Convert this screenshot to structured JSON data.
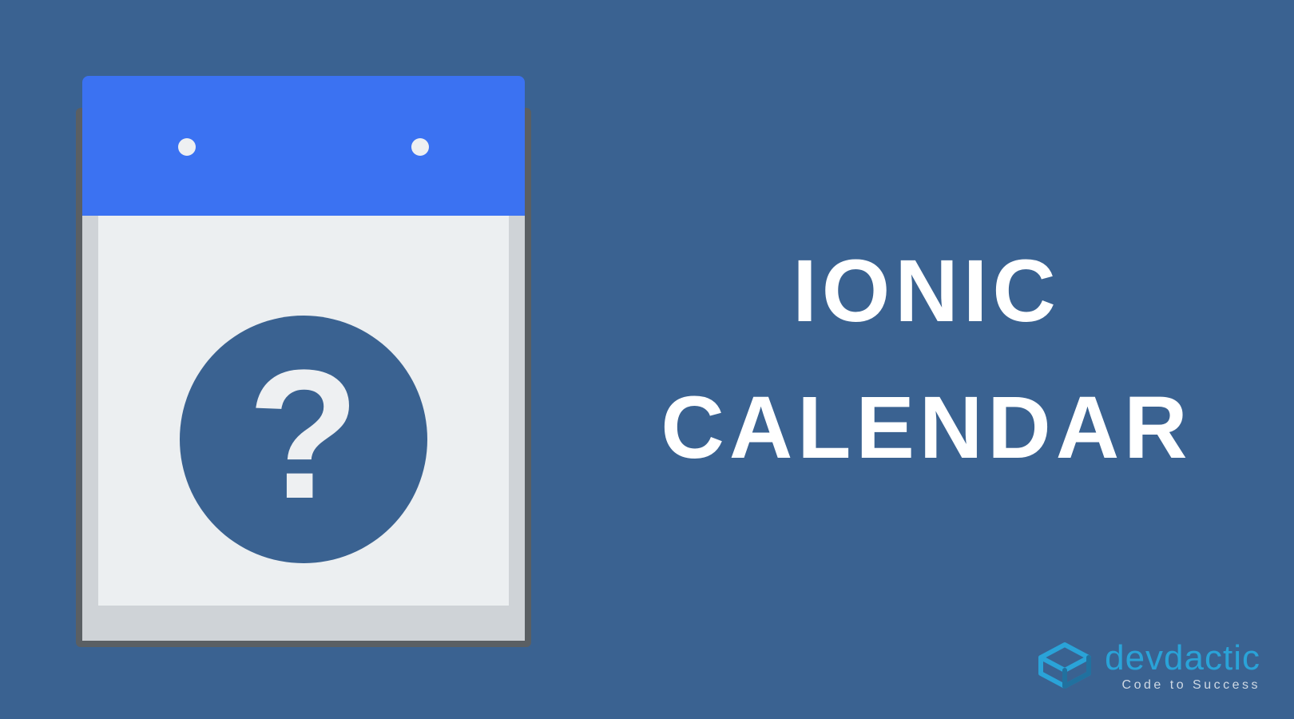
{
  "title": {
    "line1": "IONIC",
    "line2": "CALENDAR"
  },
  "calendar": {
    "symbol": "?"
  },
  "brand": {
    "name": "devdactic",
    "tagline": "Code to Success"
  },
  "colors": {
    "background": "#3a6291",
    "accent": "#3b72f2",
    "brand": "#2aa3d8"
  }
}
